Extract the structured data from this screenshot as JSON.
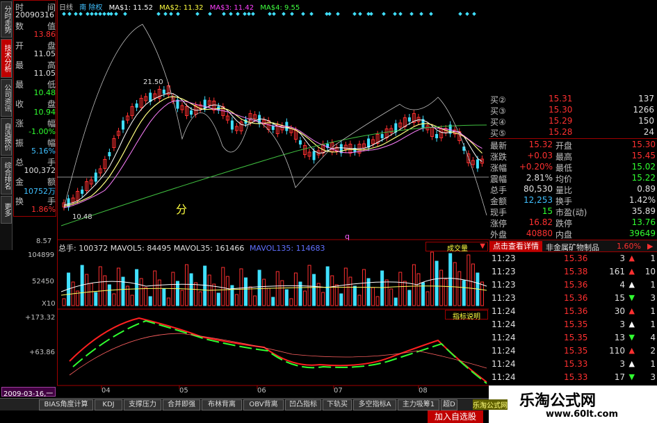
{
  "leftnav": [
    "分时走势",
    "技术分析",
    "公司资讯",
    "自选报价",
    "综合排名",
    "更多"
  ],
  "info": {
    "time_label": "时",
    "time_label2": "间",
    "date": "20090316",
    "rows": [
      {
        "l": "数",
        "r": "值",
        "v": "13.86",
        "c": "#ff3030"
      },
      {
        "l": "开",
        "r": "盘",
        "v": "11.05",
        "c": "#e0e0e0"
      },
      {
        "l": "最",
        "r": "高",
        "v": "11.05",
        "c": "#e0e0e0"
      },
      {
        "l": "最",
        "r": "低",
        "v": "10.48",
        "c": "#30ff30"
      },
      {
        "l": "收",
        "r": "盘",
        "v": "10.94",
        "c": "#30ff30"
      },
      {
        "l": "涨",
        "r": "幅",
        "v": "-1.00%",
        "c": "#30ff30"
      },
      {
        "l": "振",
        "r": "幅",
        "v": "5.16%",
        "c": "#40c0ff"
      },
      {
        "l": "总",
        "r": "手",
        "v": "100,372",
        "c": "#e0e0e0"
      },
      {
        "l": "金",
        "r": "额",
        "v": "10752万",
        "c": "#40c0ff"
      },
      {
        "l": "换",
        "r": "手",
        "v": "1.86%",
        "c": "#ff3030"
      }
    ]
  },
  "chart": {
    "period": "日线",
    "flags": "南 除权",
    "ma1": "MA$1: 11.52",
    "ma2": "MA$2: 11.32",
    "ma3": "MA$3: 11.42",
    "ma4": "MA$4: 9.55",
    "high_mark": "21.50",
    "low_mark": "10.48",
    "low_axis": "8.57",
    "center_text": "分",
    "q_mark": "q",
    "vol_legend": "总手: 100372  MAVOL5: 84495  MAVOL35: 161466",
    "vol_legend2": "MAVOL135: 114683",
    "vol_label": "成交量",
    "vol_ticks": [
      "104899",
      "52450",
      "X10"
    ],
    "ind_label": "指标说明",
    "ind_ticks": [
      "+173.32",
      "+63.86"
    ],
    "months": [
      "04",
      "05",
      "06",
      "07",
      "08"
    ],
    "date_box": "2009-03-16,一"
  },
  "quote": {
    "buys": [
      {
        "label": "买②",
        "price": "15.31",
        "vol": "137"
      },
      {
        "label": "买③",
        "price": "15.30",
        "vol": "1266"
      },
      {
        "label": "买④",
        "price": "15.29",
        "vol": "150"
      },
      {
        "label": "买⑤",
        "price": "15.28",
        "vol": "24"
      }
    ],
    "stats": [
      {
        "l1": "最新",
        "v1": "15.32",
        "c1": "#ff3030",
        "l2": "开盘",
        "v2": "15.30",
        "c2": "#ff3030"
      },
      {
        "l1": "涨跌",
        "v1": "+0.03",
        "c1": "#ff3030",
        "l2": "最高",
        "v2": "15.45",
        "c2": "#ff3030"
      },
      {
        "l1": "涨幅",
        "v1": "+0.20%",
        "c1": "#ff3030",
        "l2": "最低",
        "v2": "15.02",
        "c2": "#30ff30"
      },
      {
        "l1": "震幅",
        "v1": "2.81%",
        "c1": "#e0e0e0",
        "l2": "均价",
        "v2": "15.22",
        "c2": "#30ff30"
      },
      {
        "l1": "总手",
        "v1": "80,530",
        "c1": "#e0e0e0",
        "l2": "量比",
        "v2": "0.89",
        "c2": "#e0e0e0"
      },
      {
        "l1": "金额",
        "v1": "12,253",
        "c1": "#40c0ff",
        "l2": "换手",
        "v2": "1.42%",
        "c2": "#e0e0e0"
      },
      {
        "l1": "现手",
        "v1": "15",
        "c1": "#30ff30",
        "l2": "市盈(动)",
        "v2": "35.89",
        "c2": "#e0e0e0"
      },
      {
        "l1": "涨停",
        "v1": "16.82",
        "c1": "#ff3030",
        "l2": "跌停",
        "v2": "13.76",
        "c2": "#30ff30"
      },
      {
        "l1": "外盘",
        "v1": "40880",
        "c1": "#ff3030",
        "l2": "内盘",
        "v2": "39649",
        "c2": "#30ff30"
      }
    ],
    "tick_head_btn": "点击查看详情",
    "industry": "非金属矿物制品",
    "industry_pct": "1.60%",
    "ticks": [
      {
        "t": "11:23",
        "p": "15.36",
        "pc": "#ff3030",
        "v": "3",
        "arrow": "up-red",
        "n": "1"
      },
      {
        "t": "11:23",
        "p": "15.38",
        "pc": "#ff3030",
        "v": "161",
        "arrow": "up-red",
        "n": "10"
      },
      {
        "t": "11:23",
        "p": "15.36",
        "pc": "#ff3030",
        "v": "4",
        "arrow": "up-white",
        "n": "1"
      },
      {
        "t": "11:23",
        "p": "15.36",
        "pc": "#ff3030",
        "v": "15",
        "arrow": "down-green",
        "n": "3"
      },
      {
        "t": "11:24",
        "p": "15.36",
        "pc": "#ff3030",
        "v": "30",
        "arrow": "up-red",
        "n": "1"
      },
      {
        "t": "11:24",
        "p": "15.35",
        "pc": "#ff3030",
        "v": "3",
        "arrow": "up-white",
        "n": "1"
      },
      {
        "t": "11:24",
        "p": "15.35",
        "pc": "#ff3030",
        "v": "13",
        "arrow": "down-green",
        "n": "4"
      },
      {
        "t": "11:24",
        "p": "15.35",
        "pc": "#ff3030",
        "v": "110",
        "arrow": "up-red",
        "n": "2"
      },
      {
        "t": "11:24",
        "p": "15.33",
        "pc": "#ff3030",
        "v": "3",
        "arrow": "up-white",
        "n": "1"
      },
      {
        "t": "11:24",
        "p": "15.33",
        "pc": "#ff3030",
        "v": "17",
        "arrow": "down-green",
        "n": "3"
      }
    ]
  },
  "bottomtabs": [
    "BIAS角度计算",
    "KDJ",
    "支撑压力",
    "合并即强",
    "布林背离",
    "OBV背离",
    "凹凸指标",
    "下轨买",
    "多空指标A",
    "主力吸筹1",
    "超D"
  ],
  "add_button": "加入自选股",
  "watermark": {
    "title": "乐淘公式网",
    "url": "www.60lt.com",
    "overlay": "乐淘公式网"
  },
  "colors": {
    "up": "#ff3030",
    "down": "#30ff30",
    "cyan": "#40e0ff",
    "frame": "#a00000"
  }
}
